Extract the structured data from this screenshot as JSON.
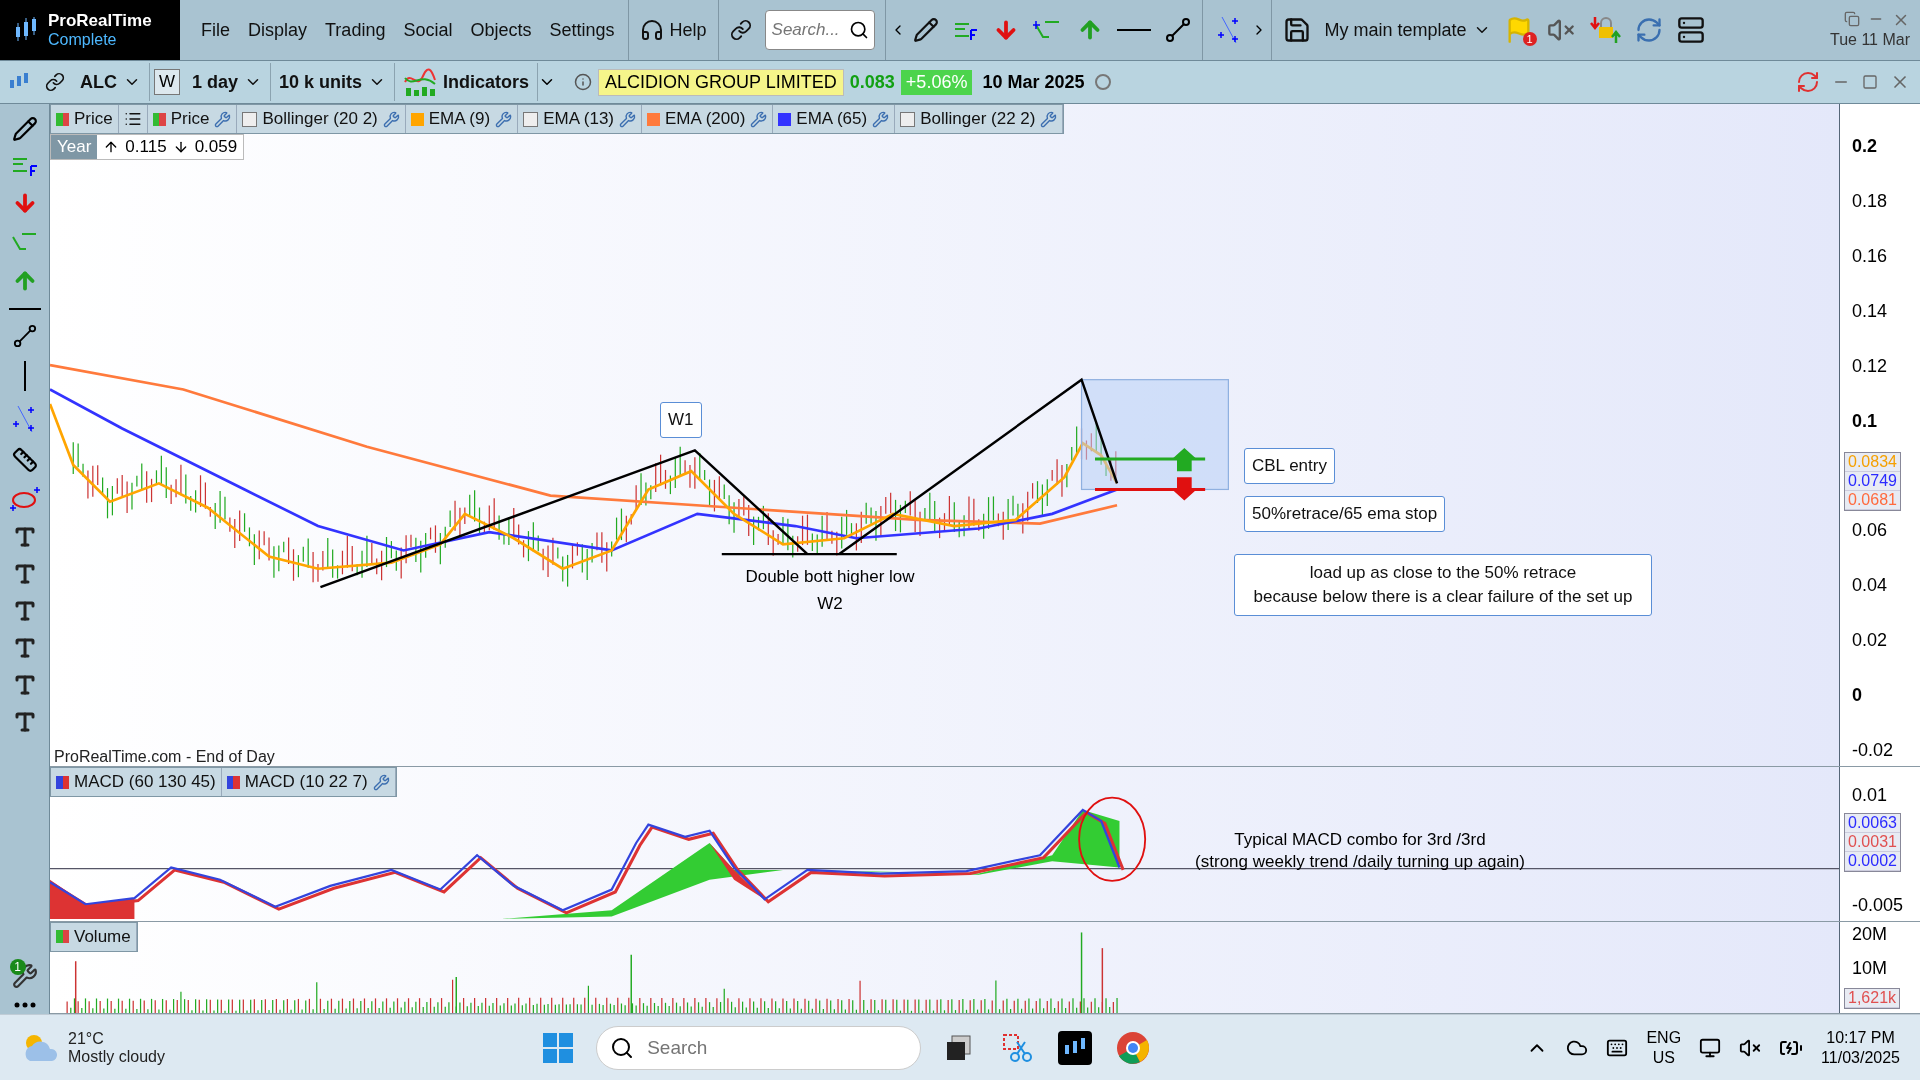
{
  "app": {
    "name": "ProRealTime",
    "edition": "Complete"
  },
  "menu": [
    {
      "label": "File"
    },
    {
      "label": "Display"
    },
    {
      "label": "Trading"
    },
    {
      "label": "Social"
    },
    {
      "label": "Objects"
    },
    {
      "label": "Settings"
    }
  ],
  "help": "Help",
  "search": {
    "placeholder": "Search..."
  },
  "template": "My main template",
  "flag_count": "1",
  "top_date": "Tue 11 Mar",
  "instrument": {
    "symbol": "ALC",
    "period_letter": "W",
    "timeframe": "1 day",
    "units": "10 k units",
    "indicators": "Indicators",
    "company": "ALCIDION GROUP LIMITED",
    "price": "0.083",
    "change": "+5.06%",
    "date": "10 Mar 2025"
  },
  "legend": [
    {
      "kind": "price",
      "label": "Price"
    },
    {
      "kind": "list"
    },
    {
      "kind": "price",
      "label": "Price",
      "wrench": true
    },
    {
      "kind": "checkbox",
      "checked": false,
      "label": "Bollinger (20 2)",
      "wrench": true
    },
    {
      "kind": "swatch",
      "color": "#ffa500",
      "label": "EMA (9)",
      "wrench": true
    },
    {
      "kind": "checkbox",
      "checked": false,
      "label": "EMA (13)",
      "wrench": true
    },
    {
      "kind": "swatch",
      "color": "#ff7a3c",
      "label": "EMA (200)",
      "wrench": true
    },
    {
      "kind": "swatch",
      "color": "#3333ff",
      "label": "EMA (65)",
      "wrench": true
    },
    {
      "kind": "checkbox",
      "checked": false,
      "label": "Bollinger (22 2)",
      "wrench": true
    }
  ],
  "range": {
    "label": "Year",
    "high": "0.115",
    "low": "0.059"
  },
  "annotations": {
    "w1": "W1",
    "double_bottom": [
      "Double bott higher low",
      "W2"
    ],
    "entry": "CBL entry",
    "stop": "50%retrace/65 ema stop",
    "note": [
      "load up as close to the 50% retrace",
      "because below there is a clear failure of the set up"
    ]
  },
  "source": "ProRealTime.com - End of Day",
  "price_axis": [
    {
      "label": "0.2",
      "major": true
    },
    {
      "label": "0.18",
      "major": false
    },
    {
      "label": "0.16",
      "major": false
    },
    {
      "label": "0.14",
      "major": false
    },
    {
      "label": "0.12",
      "major": false
    },
    {
      "label": "0.1",
      "major": true
    },
    {
      "label": "0.06",
      "major": false
    },
    {
      "label": "0.04",
      "major": false
    },
    {
      "label": "0.02",
      "major": false
    },
    {
      "label": "0",
      "major": true
    },
    {
      "label": "-0.02",
      "major": false
    }
  ],
  "price_values": [
    {
      "text": "0.0834",
      "color": "#f5a000"
    },
    {
      "text": "0.0749",
      "color": "#2b2bff"
    },
    {
      "text": "0.0681",
      "color": "#ff6a3d"
    }
  ],
  "macd": {
    "legend": [
      "MACD (60 130 45)",
      "MACD (10 22 7)"
    ],
    "note": [
      "Typical MACD combo for 3rd /3rd",
      "(strong weekly trend /daily turning up again)"
    ],
    "axis": [
      "0.01",
      "-0.005"
    ],
    "values": [
      {
        "text": "0.0063",
        "color": "#2b2bff"
      },
      {
        "text": "0.0031",
        "color": "#e05050"
      },
      {
        "text": "0.0002",
        "color": "#2b2bff"
      }
    ]
  },
  "volume": {
    "label": "Volume",
    "axis": [
      "20M",
      "10M"
    ],
    "value": {
      "text": "1,621k",
      "color": "#e05050"
    },
    "alert_count": "1"
  },
  "taskbar": {
    "temperature": "21°C",
    "weather": "Mostly cloudy",
    "search": {
      "placeholder": "Search"
    },
    "language": "ENG",
    "region": "US",
    "time": "10:17 PM",
    "date": "11/03/2025"
  }
}
